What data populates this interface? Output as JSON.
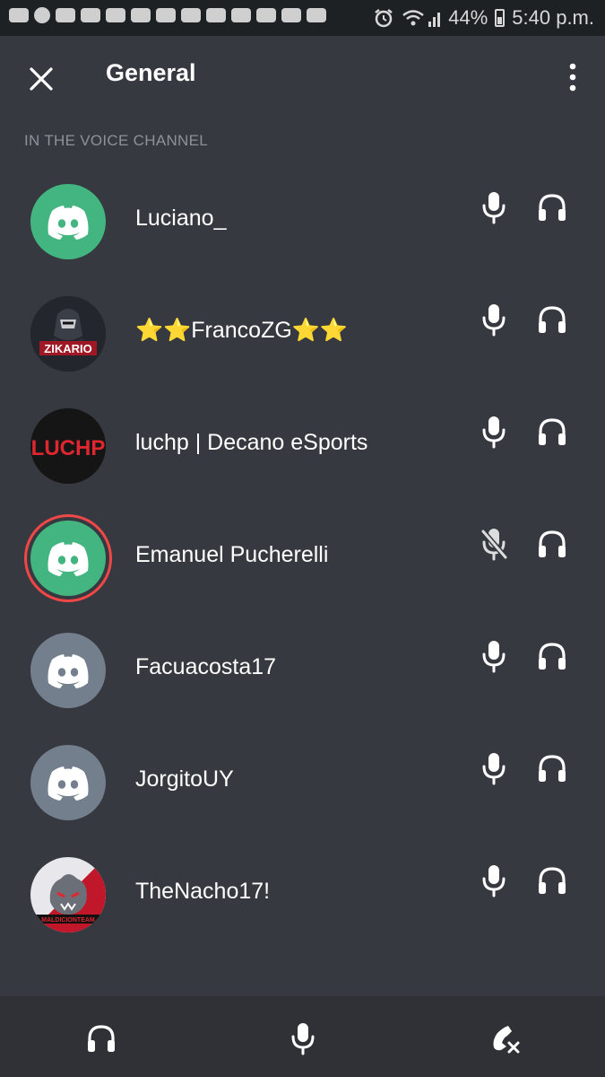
{
  "status_bar": {
    "battery": "44%",
    "time": "5:40 p.m."
  },
  "header": {
    "title": "General"
  },
  "section_label": "IN THE VOICE CHANNEL",
  "members": [
    {
      "name": "Luciano_",
      "avatar": "discord-logo-green",
      "mic": "on"
    },
    {
      "name": "⭐⭐FrancoZG⭐⭐",
      "avatar": "ZIKARIO",
      "mic": "on"
    },
    {
      "name": "luchp | Decano eSports",
      "avatar": "LUCHP",
      "mic": "on"
    },
    {
      "name": "Emanuel Pucherelli",
      "avatar": "discord-logo-green",
      "mic": "muted",
      "speaking": true
    },
    {
      "name": "Facuacosta17",
      "avatar": "discord-logo-gray",
      "mic": "on"
    },
    {
      "name": "JorgitoUY",
      "avatar": "discord-logo-gray",
      "mic": "on"
    },
    {
      "name": "TheNacho17!",
      "avatar": "MALDICIONTEAM",
      "mic": "on"
    }
  ],
  "colors": {
    "background": "#36393f",
    "bottom_bar": "#2f3136",
    "discord_green": "#43b581",
    "discord_gray": "#747f8d",
    "speaking_ring": "#f04747"
  },
  "icons": {
    "close": "close-icon",
    "more": "more-vertical-icon",
    "mic": "microphone-icon",
    "mic_muted": "microphone-muted-icon",
    "headphones": "headphones-icon",
    "disconnect": "disconnect-call-icon"
  }
}
